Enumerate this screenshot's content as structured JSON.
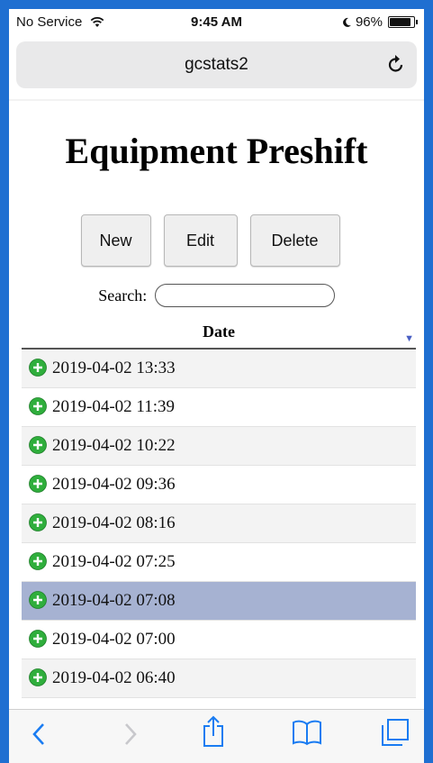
{
  "status": {
    "carrier": "No Service",
    "time": "9:45 AM",
    "battery": "96%",
    "battery_level": 0.96
  },
  "browser": {
    "host": "gcstats2"
  },
  "page": {
    "title": "Equipment Preshift",
    "buttons": {
      "new": "New",
      "edit": "Edit",
      "delete": "Delete"
    },
    "search_label": "Search:",
    "search_value": "",
    "table": {
      "column_header": "Date",
      "sort": "descending",
      "selected_index": 6,
      "rows": [
        "2019-04-02 13:33",
        "2019-04-02 11:39",
        "2019-04-02 10:22",
        "2019-04-02 09:36",
        "2019-04-02 08:16",
        "2019-04-02 07:25",
        "2019-04-02 07:08",
        "2019-04-02 07:00",
        "2019-04-02 06:40"
      ]
    }
  },
  "colors": {
    "frame": "#1f6fd1",
    "selected_row": "#a6b2d2",
    "plus_icon": "#2fae3c",
    "ios_blue": "#1a7cf2"
  },
  "icons": [
    "wifi-icon",
    "moon-icon",
    "battery-icon",
    "reload-icon",
    "plus-circle-icon",
    "back-icon",
    "forward-icon",
    "share-icon",
    "bookmarks-icon",
    "tabs-icon"
  ]
}
